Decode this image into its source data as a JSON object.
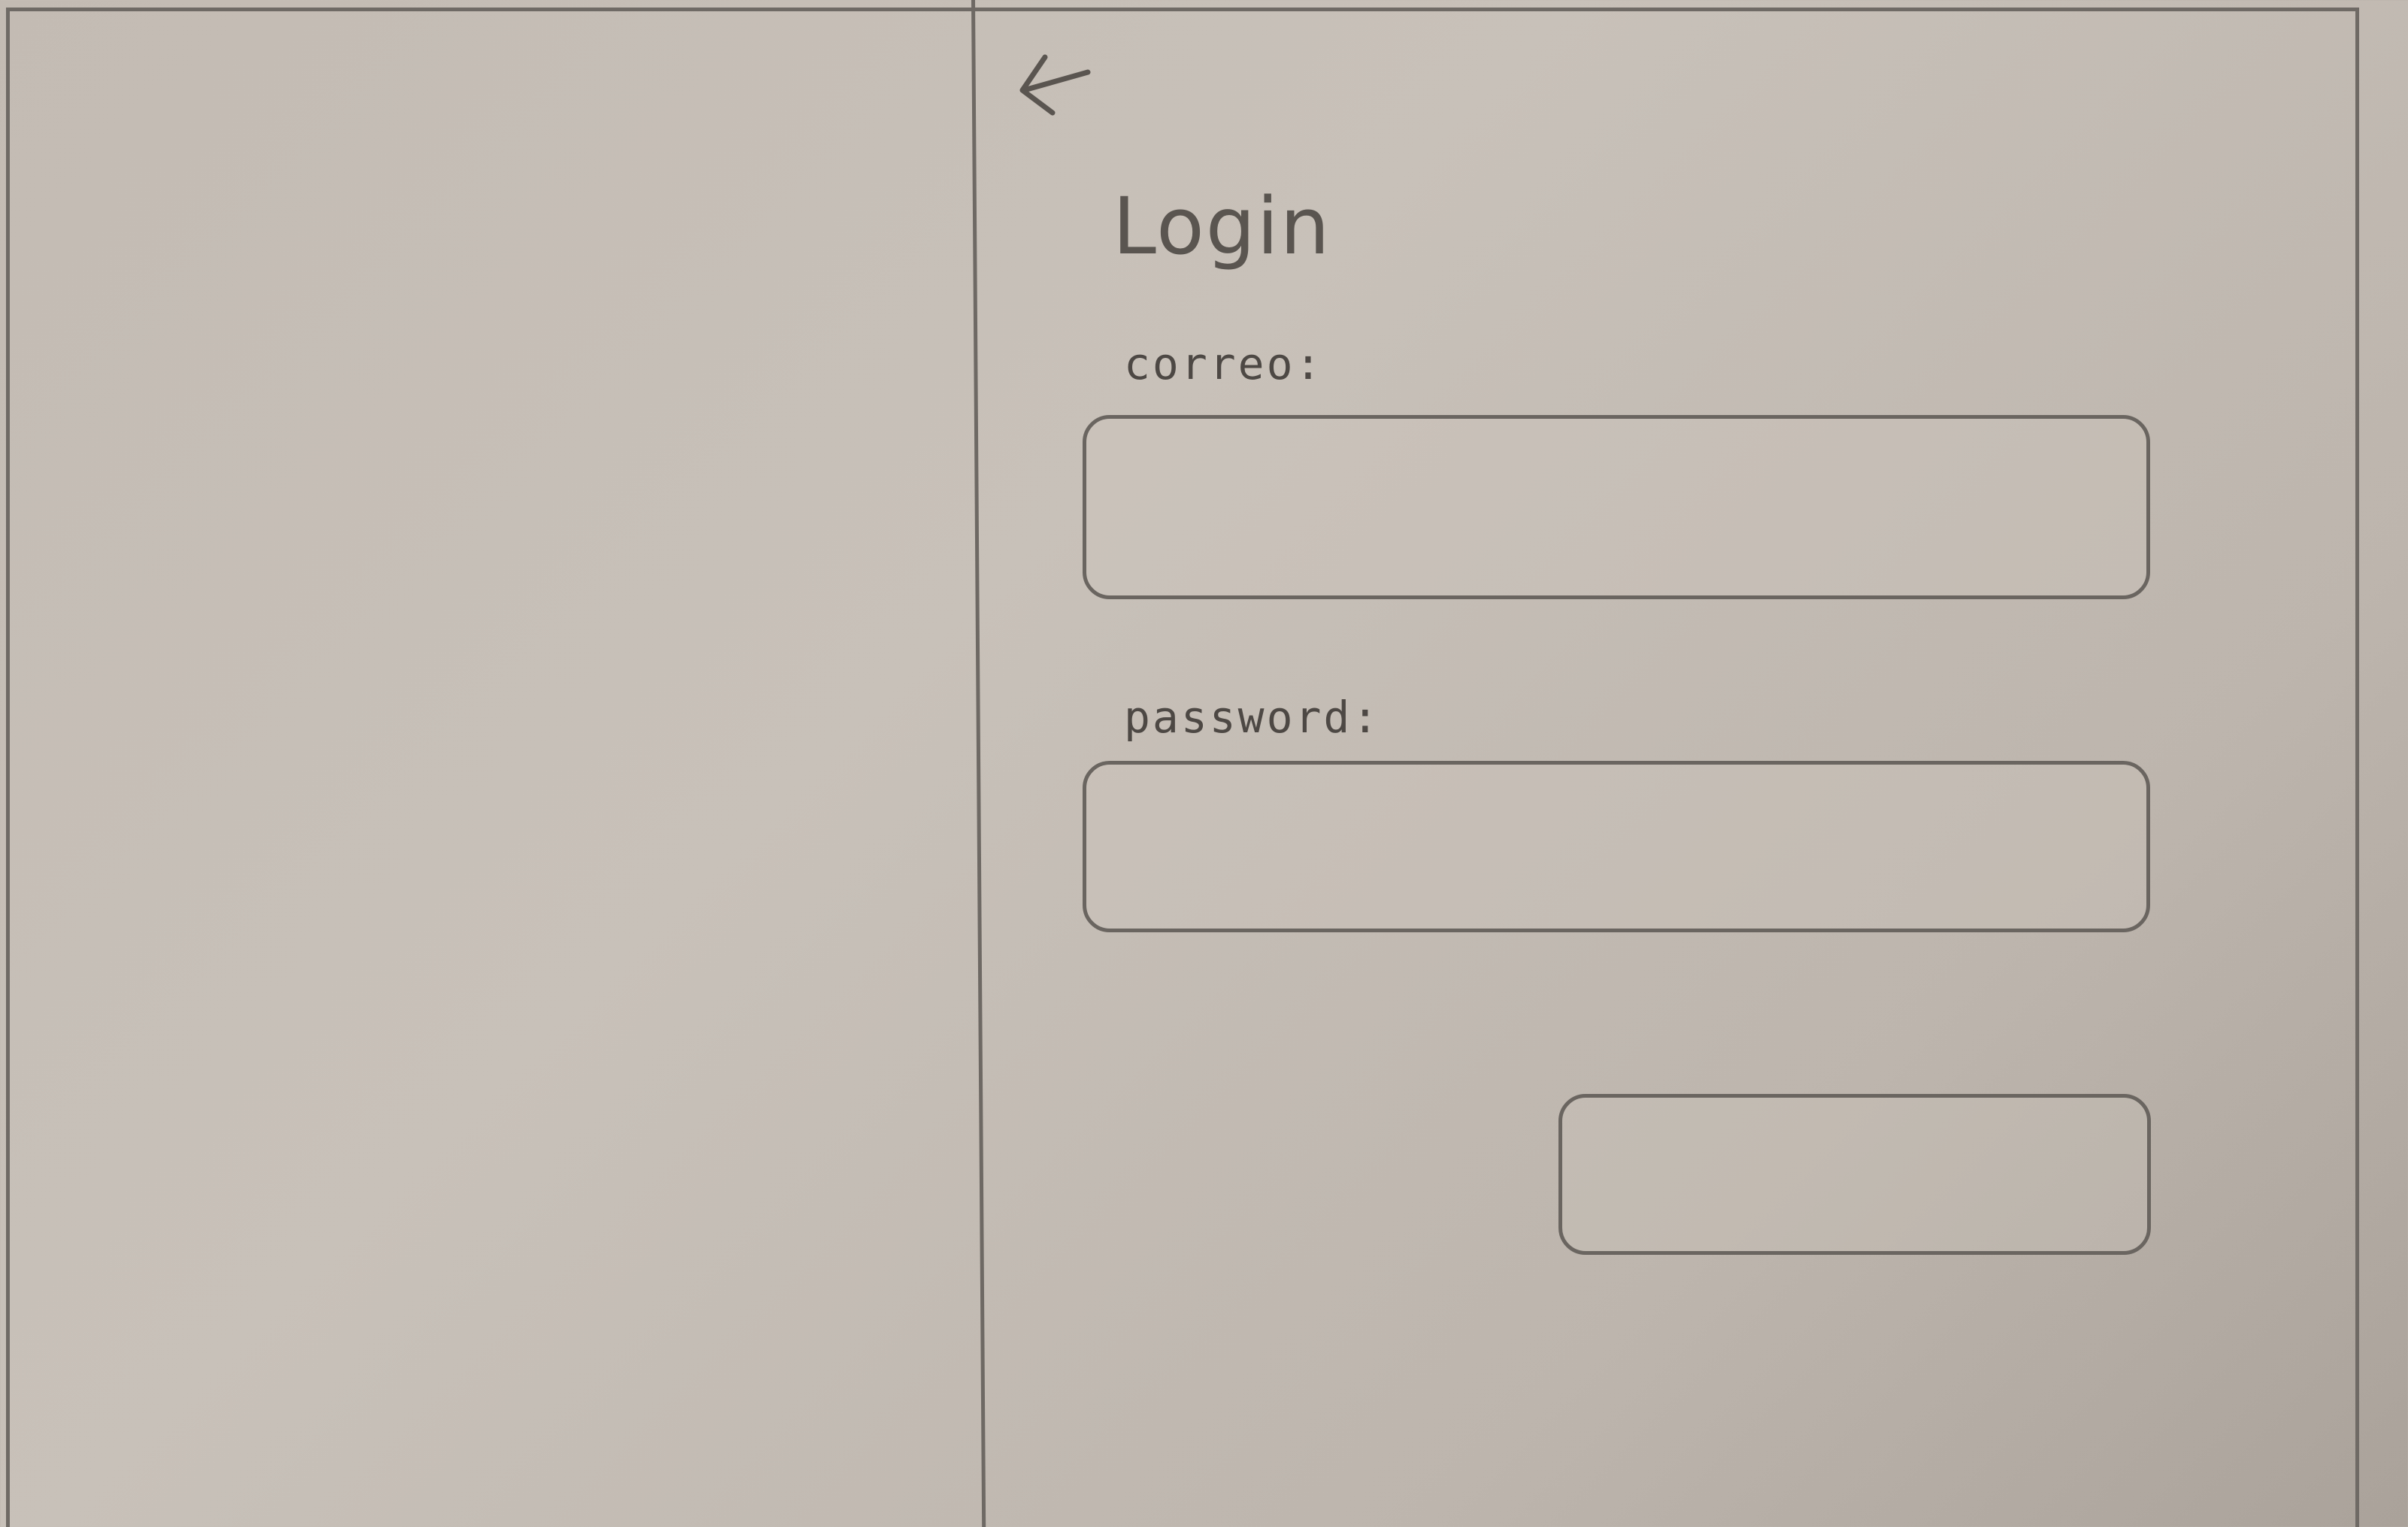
{
  "screen": {
    "title": "Login",
    "back_icon": "arrow-left-icon"
  },
  "form": {
    "email_label": "correo:",
    "email_value": "",
    "password_label": "password:",
    "password_value": "",
    "submit_label": ""
  },
  "colors": {
    "paper": "#c3bbb3",
    "pencil": "#6a6560"
  }
}
